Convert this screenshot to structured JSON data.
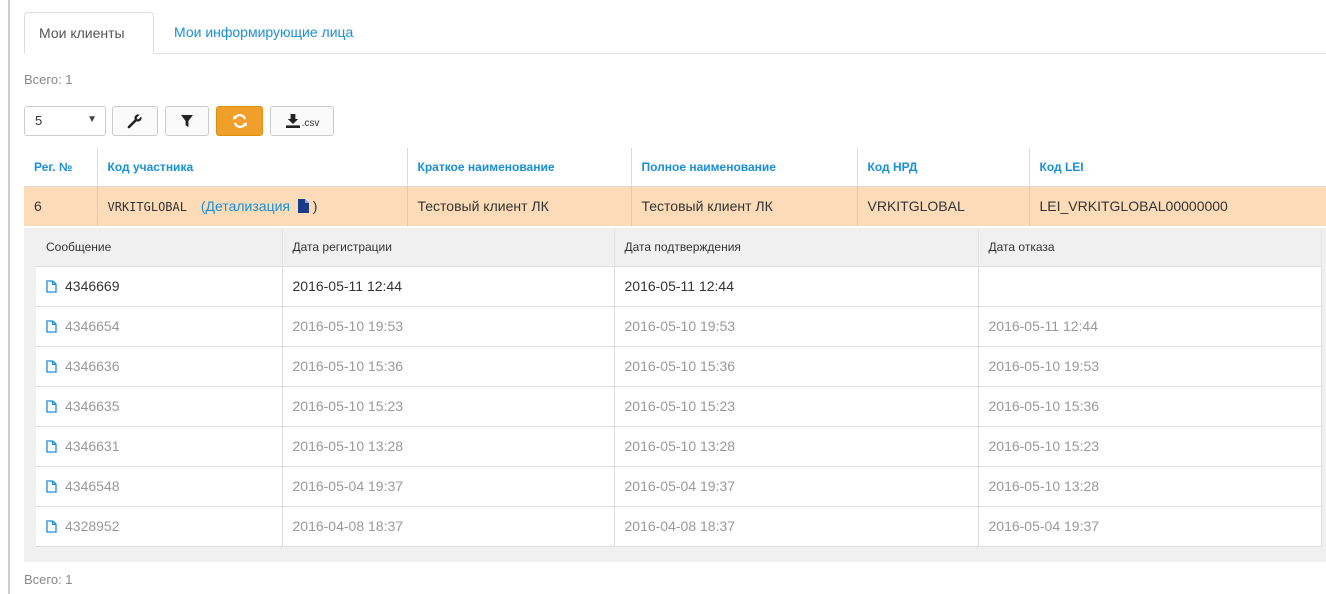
{
  "tabs": {
    "my_clients": "Мои клиенты",
    "my_informers": "Мои информирующие лица"
  },
  "total": {
    "top": "Всего: 1",
    "bottom": "Всего: 1"
  },
  "toolbar": {
    "page_size": "5",
    "icons": [
      "wrench-icon",
      "filter-icon",
      "refresh-icon",
      "download-icon"
    ],
    "csv_label": ".csv",
    "refresh_color": "#f0a02a"
  },
  "main_table": {
    "headers": [
      "Рег. №",
      "Код участника",
      "Краткое наименование",
      "Полное наименование",
      "Код НРД",
      "Код LEI"
    ],
    "row": {
      "reg_no": "6",
      "code": "VRKITGLOBAL",
      "details_open": "(",
      "details_link": "Детализация",
      "details_close": ")",
      "short_name": "Тестовый клиент ЛК",
      "full_name": "Тестовый клиент ЛК",
      "nrd_code": "VRKITGLOBAL",
      "lei_code": "LEI_VRKITGLOBAL00000000"
    },
    "highlight_color": "#fcdcb8",
    "header_color": "#1a8fd6"
  },
  "detail_table": {
    "headers": [
      "Сообщение",
      "Дата регистрации",
      "Дата подтверждения",
      "Дата отказа"
    ],
    "rows": [
      {
        "msg": "4346669",
        "reg": "2016-05-11 12:44",
        "confirm": "2016-05-11 12:44",
        "reject": ""
      },
      {
        "msg": "4346654",
        "reg": "2016-05-10 19:53",
        "confirm": "2016-05-10 19:53",
        "reject": "2016-05-11 12:44"
      },
      {
        "msg": "4346636",
        "reg": "2016-05-10 15:36",
        "confirm": "2016-05-10 15:36",
        "reject": "2016-05-10 19:53"
      },
      {
        "msg": "4346635",
        "reg": "2016-05-10 15:23",
        "confirm": "2016-05-10 15:23",
        "reject": "2016-05-10 15:36"
      },
      {
        "msg": "4346631",
        "reg": "2016-05-10 13:28",
        "confirm": "2016-05-10 13:28",
        "reject": "2016-05-10 15:23"
      },
      {
        "msg": "4346548",
        "reg": "2016-05-04 19:37",
        "confirm": "2016-05-04 19:37",
        "reject": "2016-05-10 13:28"
      },
      {
        "msg": "4328952",
        "reg": "2016-04-08 18:37",
        "confirm": "2016-04-08 18:37",
        "reject": "2016-05-04 19:37"
      }
    ]
  }
}
